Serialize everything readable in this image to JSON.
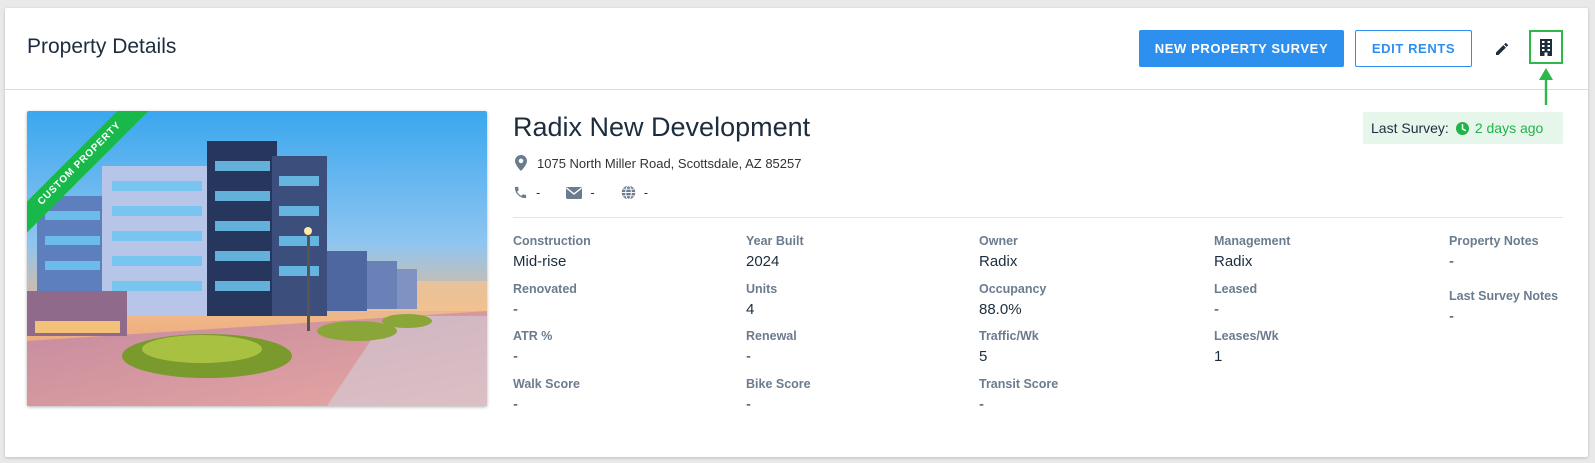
{
  "header": {
    "title": "Property Details",
    "new_survey_label": "NEW PROPERTY SURVEY",
    "edit_rents_label": "EDIT RENTS",
    "edit_icon": "pencil-icon",
    "property_icon": "building-icon"
  },
  "colors": {
    "primary": "#2e90ee",
    "success": "#22b34a",
    "ribbon": "#19b84b",
    "badge_bg": "#e6f6ea"
  },
  "property": {
    "ribbon": "CUSTOM PROPERTY",
    "name": "Radix New Development",
    "address": "1075 North Miller Road, Scottsdale, AZ 85257",
    "phone": "-",
    "email": "-",
    "website": "-",
    "last_survey_label": "Last Survey:",
    "last_survey_value": "2 days ago"
  },
  "details": {
    "construction": {
      "label": "Construction",
      "value": "Mid-rise"
    },
    "year_built": {
      "label": "Year Built",
      "value": "2024"
    },
    "owner": {
      "label": "Owner",
      "value": "Radix"
    },
    "management": {
      "label": "Management",
      "value": "Radix"
    },
    "property_notes": {
      "label": "Property Notes",
      "value": "-"
    },
    "renovated": {
      "label": "Renovated",
      "value": "-"
    },
    "units": {
      "label": "Units",
      "value": "4"
    },
    "occupancy": {
      "label": "Occupancy",
      "value": "88.0%"
    },
    "leased": {
      "label": "Leased",
      "value": "-"
    },
    "last_survey_notes": {
      "label": "Last Survey Notes",
      "value": "-"
    },
    "atr": {
      "label": "ATR %",
      "value": "-"
    },
    "renewal": {
      "label": "Renewal",
      "value": "-"
    },
    "traffic": {
      "label": "Traffic/Wk",
      "value": "5"
    },
    "leases": {
      "label": "Leases/Wk",
      "value": "1"
    },
    "walk_score": {
      "label": "Walk Score",
      "value": "-"
    },
    "bike_score": {
      "label": "Bike Score",
      "value": "-"
    },
    "transit_score": {
      "label": "Transit Score",
      "value": "-"
    }
  }
}
